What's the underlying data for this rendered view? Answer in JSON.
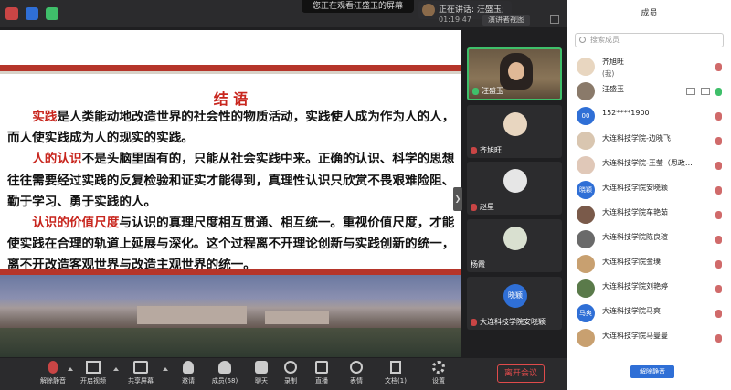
{
  "topbar": {
    "notice": "您正在观看汪盛玉的屏幕",
    "speaking": "正在讲话: 汪盛玉;",
    "timer": "01:19:47",
    "view_mode": "演讲者视图"
  },
  "slide": {
    "title": "结 语",
    "p1_hl": "实践",
    "p1": "是人类能动地改造世界的社会性的物质活动，实践使人成为作为人的人，而人使实践成为人的现实的实践。",
    "p2_hl": "人的认识",
    "p2": "不是头脑里固有的，只能从社会实践中来。正确的认识、科学的思想往往需要经过实践的反复检验和证实才能得到，真理性认识只欣赏不畏艰难险阻、勤于学习、勇于实践的人。",
    "p3_hl": "认识的价值尺度",
    "p3": "与认识的真理尺度相互贯通、相互统一。重视价值尺度，才能使实践在合理的轨道上延展与深化。这个过程离不开理论创新与实践创新的统一，离不开改造客观世界与改造主观世界的统一。"
  },
  "tiles": [
    "汪盛玉",
    "齐旭旺",
    "赵星",
    "杨霞",
    "大连科技学院安晓颖"
  ],
  "tile_avatar_text": "晓颖",
  "toolbar": {
    "unmute": "解除静音",
    "video": "开启视频",
    "share": "共享屏幕",
    "invite": "邀请",
    "members": "成员(68)",
    "chat": "聊天",
    "record": "录制",
    "live": "直播",
    "reaction": "表情",
    "docs": "文档(1)",
    "settings": "设置",
    "leave": "离开会议"
  },
  "panel": {
    "title": "成员",
    "search_placeholder": "搜索成员",
    "members": [
      {
        "name": "齐旭旺",
        "sub": "(我)"
      },
      {
        "name": "汪盛玉",
        "sub": ""
      },
      {
        "name": "152****1900",
        "sub": ""
      },
      {
        "name": "大连科技学院-边晓飞",
        "sub": ""
      },
      {
        "name": "大连科技学院-王莹（思政…",
        "sub": ""
      },
      {
        "name": "大连科技学院安晓颖",
        "sub": ""
      },
      {
        "name": "大连科技学院车艳茹",
        "sub": ""
      },
      {
        "name": "大连科技学院陈良瑄",
        "sub": ""
      },
      {
        "name": "大连科技学院金璞",
        "sub": ""
      },
      {
        "name": "大连科技学院刘艳婷",
        "sub": ""
      },
      {
        "name": "大连科技学院马爽",
        "sub": ""
      },
      {
        "name": "大连科技学院马曼曼",
        "sub": ""
      }
    ],
    "avatars": [
      "",
      "",
      "00",
      "",
      "",
      "晓颖",
      "",
      "",
      "",
      "",
      "马爽",
      ""
    ],
    "unmute_all": "解除静音"
  }
}
